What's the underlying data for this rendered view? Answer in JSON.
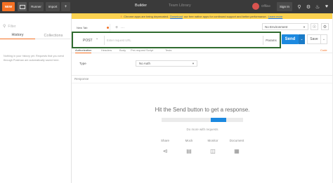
{
  "topbar": {
    "new_label": "NEW",
    "runner_label": "Runner",
    "import_label": "Import",
    "new_window_icon": "+",
    "builder_label": "Builder",
    "team_library_label": "Team Library",
    "offline_label": "Offline",
    "signin_label": "Sign In",
    "icons": [
      "search-icon",
      "gear-icon",
      "bell-icon",
      "heart-icon",
      "menu-icon"
    ]
  },
  "notice": {
    "prefix": "Chrome apps are being deprecated.",
    "link1": "Download",
    "middle": "our free native apps for continued support and better performance.",
    "link2": "Learn more"
  },
  "sidebar": {
    "filter_placeholder": "Filter",
    "tabs": [
      "History",
      "Collections"
    ],
    "empty_text": "Nothing in your history yet. Requests that you send through Postman are automatically saved here."
  },
  "tabs": {
    "request_tab_label": "New Tab",
    "add_label": "+",
    "menu_label": "···",
    "environment_label": "No Environment"
  },
  "request": {
    "method": "POST",
    "url_placeholder": "Enter request URL",
    "params_label": "Params",
    "send_label": "Send",
    "save_label": "Save"
  },
  "subtabs": {
    "items": [
      "Authorization",
      "Headers",
      "Body",
      "Pre-request Script",
      "Tests"
    ],
    "code_label": "Code"
  },
  "auth": {
    "type_label": "Type",
    "type_value": "No Auth"
  },
  "response": {
    "label": "Response",
    "hint": "Hit the Send button to get a response.",
    "sub": "Do more with requests",
    "features": [
      "Share",
      "Mock",
      "Monitor",
      "Document"
    ]
  },
  "colors": {
    "accent": "#f47023",
    "send": "#1c89e0",
    "highlight_border": "#2f6b2f",
    "notice_bg": "#fcd250"
  }
}
